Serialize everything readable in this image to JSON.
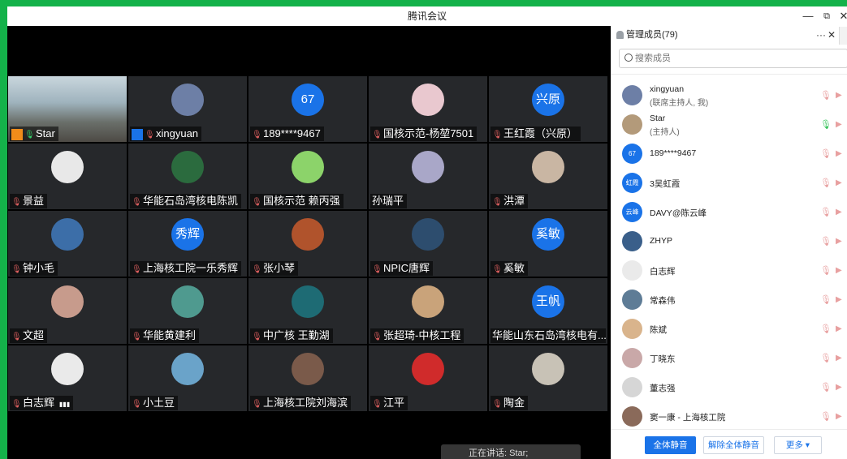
{
  "window": {
    "title": "腾讯会议",
    "min": "—",
    "restore": "⧉",
    "close": "✕"
  },
  "tiles": [
    {
      "name": "Star",
      "mic": "on",
      "badge": "host",
      "avatar": "room"
    },
    {
      "name": "xingyuan",
      "mic": "off",
      "badge": "cohost",
      "avatar": "photo",
      "color": "#6d7fa6"
    },
    {
      "name": "189****9467",
      "mic": "off",
      "avatar_text": "67"
    },
    {
      "name": "国核示范-杨堃7501",
      "mic": "off",
      "avatar": "photo",
      "color": "#e9c8cf"
    },
    {
      "name": "王红霞（兴原）",
      "mic": "off",
      "avatar_text": "兴原"
    },
    {
      "name": "景益",
      "mic": "off",
      "avatar": "photo",
      "color": "#e8e8e8"
    },
    {
      "name": "华能石岛湾核电陈凯",
      "mic": "off",
      "avatar": "photo",
      "color": "#2b6b3e"
    },
    {
      "name": "国核示范 赖丙强",
      "mic": "off",
      "avatar": "photo",
      "color": "#8cd36a"
    },
    {
      "name": "孙瑞平",
      "mic": "none",
      "avatar": "photo",
      "color": "#a9a7c8"
    },
    {
      "name": "洪潭",
      "mic": "off",
      "avatar": "photo",
      "color": "#c9b6a3"
    },
    {
      "name": "钟小毛",
      "mic": "off",
      "avatar": "photo",
      "color": "#3c6ea8"
    },
    {
      "name": "上海核工院一乐秀辉",
      "mic": "off",
      "avatar_text": "秀辉"
    },
    {
      "name": "张小琴",
      "mic": "off",
      "avatar": "photo",
      "color": "#b0532c"
    },
    {
      "name": "NPIC唐辉",
      "mic": "off",
      "avatar": "photo",
      "color": "#2d4d6e"
    },
    {
      "name": "奚敏",
      "mic": "off",
      "avatar_text": "奚敏"
    },
    {
      "name": "文超",
      "mic": "off",
      "avatar": "photo",
      "color": "#c79b8c"
    },
    {
      "name": "华能黄建利",
      "mic": "off",
      "avatar": "photo",
      "color": "#4f9a8f"
    },
    {
      "name": "中广核 王勤湖",
      "mic": "off",
      "avatar": "photo",
      "color": "#1e6b74"
    },
    {
      "name": "张超琦-中核工程",
      "mic": "off",
      "avatar": "photo",
      "color": "#c9a37a"
    },
    {
      "name": "华能山东石岛湾核电有...",
      "mic": "none",
      "avatar_text": "王帆"
    },
    {
      "name": "白志辉",
      "mic": "off",
      "signal": "▮▮▮",
      "avatar": "photo",
      "color": "#eaeaea"
    },
    {
      "name": "小土豆",
      "mic": "off",
      "avatar": "photo",
      "color": "#6aa3c9"
    },
    {
      "name": "上海核工院刘海滨",
      "mic": "off",
      "avatar": "photo",
      "color": "#7a5a4a"
    },
    {
      "name": "江平",
      "mic": "off",
      "avatar": "photo",
      "color": "#d02b2b"
    },
    {
      "name": "陶金",
      "mic": "off",
      "avatar": "photo",
      "color": "#c8c2b6"
    }
  ],
  "speaking": {
    "text": "正在讲话: Star;"
  },
  "panel": {
    "title": "管理成员(79)",
    "more": "···",
    "close": "✕",
    "search_placeholder": "搜索成员",
    "members": [
      {
        "name": "xingyuan",
        "role": "(联席主持人, 我)",
        "color": "#6d7fa6",
        "mic": "off"
      },
      {
        "name": "Star",
        "role": "(主持人)",
        "color": "#b39a7a",
        "mic": "on"
      },
      {
        "name": "189****9467",
        "avatar_text": "67",
        "mic": "off"
      },
      {
        "name": "3吴虹霞",
        "avatar_text": "虹霞",
        "mic": "off"
      },
      {
        "name": "DAVY@陈云峰",
        "avatar_text": "云峰",
        "mic": "off"
      },
      {
        "name": "ZHYP",
        "color": "#3a5f8a",
        "mic": "off"
      },
      {
        "name": "白志辉",
        "color": "#eaeaea",
        "mic": "off"
      },
      {
        "name": "常森伟",
        "color": "#5e7c96",
        "mic": "off"
      },
      {
        "name": "陈斌",
        "color": "#d9b48c",
        "mic": "off"
      },
      {
        "name": "丁晓东",
        "color": "#c9a8a8",
        "mic": "off"
      },
      {
        "name": "董志强",
        "color": "#d6d6d6",
        "mic": "off"
      },
      {
        "name": "窦一康 - 上海核工院",
        "color": "#8a6a5a",
        "mic": "off"
      }
    ],
    "buttons": {
      "mute_all": "全体静音",
      "unmute_all": "解除全体静音",
      "more": "更多 ▾"
    }
  },
  "icons": {
    "mic_off": "🎤",
    "cam": "▶"
  }
}
